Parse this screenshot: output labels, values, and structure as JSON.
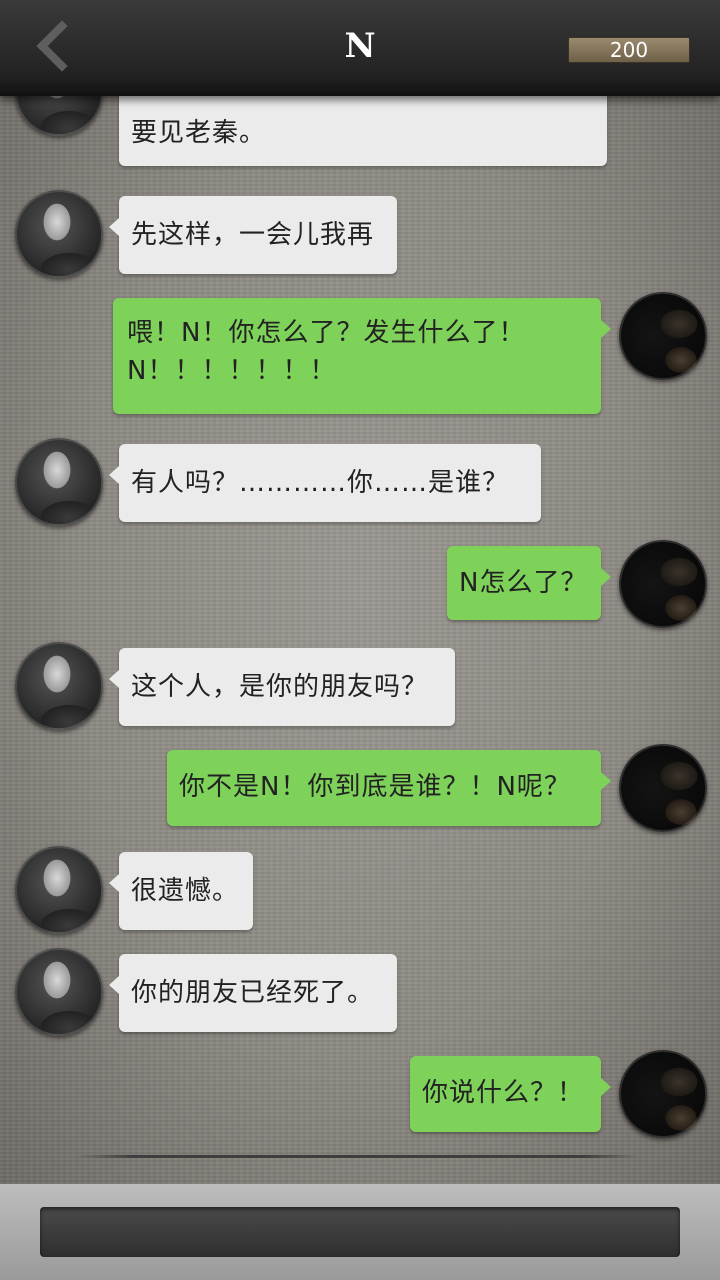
{
  "header": {
    "title": "N",
    "coins": "200",
    "back_icon": "chevron-left-icon"
  },
  "messages": [
    {
      "side": "left",
      "text": "要见老秦。",
      "partial": true
    },
    {
      "side": "left",
      "text": "先这样，一会儿我再"
    },
    {
      "side": "right",
      "text": "喂！N！你怎么了？发生什么了！N！！！！！！！"
    },
    {
      "side": "left",
      "text": "有人吗？…………你……是谁？"
    },
    {
      "side": "right",
      "text": "N怎么了？"
    },
    {
      "side": "left",
      "text": "这个人，是你的朋友吗？"
    },
    {
      "side": "right",
      "text": "你不是N！你到底是谁？！N呢？"
    },
    {
      "side": "left",
      "text": "很遗憾。"
    },
    {
      "side": "left",
      "text": "你的朋友已经死了。"
    },
    {
      "side": "right",
      "text": "你说什么？！"
    }
  ],
  "colors": {
    "bubble_left": "#ebebeb",
    "bubble_right": "#7ed25a",
    "header": "#2a2a2a",
    "coin_badge": "#8a7a5e"
  },
  "input": {
    "value": "",
    "placeholder": ""
  }
}
